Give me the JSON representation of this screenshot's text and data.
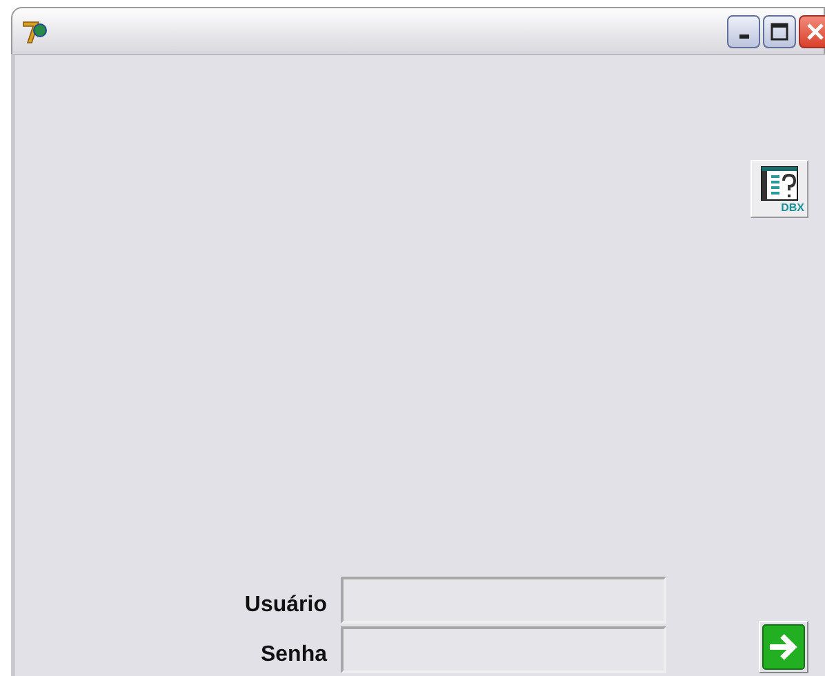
{
  "dbx_button": {
    "label": "DBX"
  },
  "login": {
    "fields": [
      {
        "label": "Usuário"
      },
      {
        "label": "Senha"
      }
    ]
  }
}
